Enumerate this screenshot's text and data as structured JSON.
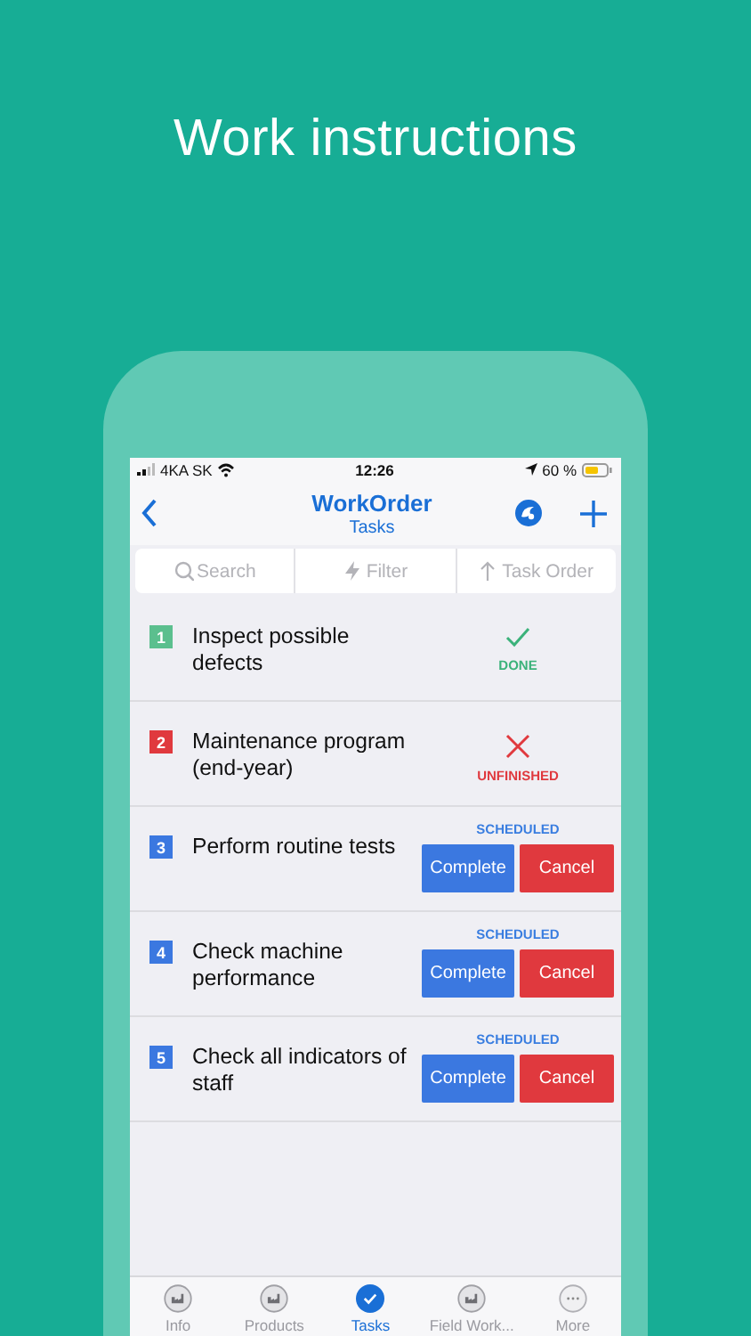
{
  "headline": "Work instructions",
  "status_bar": {
    "carrier": "4KA SK",
    "time": "12:26",
    "battery": "60 %"
  },
  "nav": {
    "title": "WorkOrder",
    "subtitle": "Tasks"
  },
  "toolbar": [
    {
      "kind": "search",
      "label": "Search"
    },
    {
      "kind": "filter",
      "label": "Filter"
    },
    {
      "kind": "sort",
      "label": "Task Order"
    }
  ],
  "tasks": [
    {
      "number": "1",
      "label": "Inspect possible defects",
      "color": "#5bbf8e",
      "status": {
        "kind": "done",
        "text": "DONE"
      }
    },
    {
      "number": "2",
      "label": "Maintenance program (end-year)",
      "color": "#e0393e",
      "status": {
        "kind": "unfinished",
        "text": "UNFINISHED"
      }
    },
    {
      "number": "3",
      "label": "Perform routine tests",
      "color": "#3b78e0",
      "status": {
        "kind": "scheduled",
        "text": "SCHEDULED"
      },
      "actions": [
        {
          "kind": "complete",
          "label": "Complete"
        },
        {
          "kind": "cancel",
          "label": "Cancel"
        }
      ]
    },
    {
      "number": "4",
      "label": "Check machine performance",
      "color": "#3b78e0",
      "status": {
        "kind": "scheduled",
        "text": "SCHEDULED"
      },
      "actions": [
        {
          "kind": "complete",
          "label": "Complete"
        },
        {
          "kind": "cancel",
          "label": "Cancel"
        }
      ]
    },
    {
      "number": "5",
      "label": "Check all indicators of staff",
      "color": "#3b78e0",
      "status": {
        "kind": "scheduled",
        "text": "SCHEDULED"
      },
      "actions": [
        {
          "kind": "complete",
          "label": "Complete"
        },
        {
          "kind": "cancel",
          "label": "Cancel"
        }
      ]
    }
  ],
  "tabs": [
    {
      "kind": "building",
      "label": "Info",
      "selected": false
    },
    {
      "kind": "building",
      "label": "Products",
      "selected": false
    },
    {
      "kind": "check",
      "label": "Tasks",
      "selected": true
    },
    {
      "kind": "building",
      "label": "Field Work...",
      "selected": false
    },
    {
      "kind": "more",
      "label": "More",
      "selected": false
    }
  ]
}
